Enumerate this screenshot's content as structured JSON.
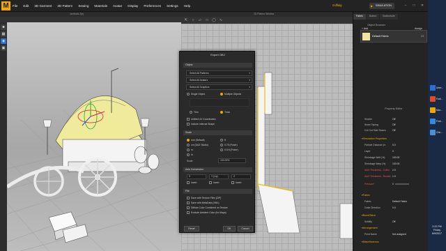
{
  "app": {
    "logo": "M",
    "user": "mdflaig",
    "simulation_label": "SIMULATION"
  },
  "menu": [
    "File",
    "Edit",
    "3D Garment",
    "2D Pattern",
    "Sewing",
    "Materials",
    "Avatar",
    "Display",
    "Preferences",
    "Settings",
    "Help"
  ],
  "window3d": {
    "title": "carnivals.Zprj"
  },
  "window2d": {
    "title": "2D Pattern Window"
  },
  "right_panel": {
    "tabs": [
      "Fabric",
      "Button",
      "Buttonhole"
    ],
    "object_browser_title": "Object Browser",
    "add_label": "+ Add",
    "assign_label": "Assign",
    "fabric": {
      "name": "Default Fabric",
      "count": "23"
    }
  },
  "property_editor": {
    "title": "Property Editor",
    "rows": [
      {
        "label": "Shader",
        "value": "Off"
      },
      {
        "label": "Seam Taping",
        "value": "Off"
      },
      {
        "label": "Cut Out Side Seams",
        "value": "Off"
      }
    ],
    "simulation_header": "Simulation Properties",
    "sim_rows": [
      {
        "label": "Particle Distance (m",
        "value": "5.0"
      },
      {
        "label": "Layer",
        "value": "0"
      },
      {
        "label": "Shrinkage Weft (%)",
        "value": "100.00"
      },
      {
        "label": "Shrinkage Warp (%)",
        "value": "100.00"
      },
      {
        "label": "Add'l Thickness - Collisi",
        "value": "2.5"
      },
      {
        "label": "Add'l Thickness - Render",
        "value": "1.0"
      }
    ],
    "pressure_label": "Pressure",
    "pressure_value": "0",
    "fabric_header": "Fabric",
    "fabric_rows": [
      {
        "label": "Fabric",
        "value": "Default Fabric"
      },
      {
        "label": "Grain Direction",
        "value": "0.0"
      }
    ],
    "bond_header": "Bond/Skive",
    "bond_rows": [
      {
        "label": "Solidify",
        "value": "Off"
      }
    ],
    "arrangement_header": "Arrangement",
    "arrangement_rows": [
      {
        "label": "Point Name",
        "value": "Not assigned"
      }
    ],
    "misc_header": "Miscellaneous"
  },
  "taskbar": {
    "items": [
      {
        "label": "Unre...",
        "color": "#2a6fd6"
      },
      {
        "label": "Furk...",
        "color": "#e24a2a"
      },
      {
        "label": "Mar...",
        "color": "#f0a800"
      },
      {
        "label": "Fork...",
        "color": "#3a86e0"
      },
      {
        "label": "Chri...",
        "color": "#4a90d9"
      }
    ],
    "time": "2:22 PM",
    "day": "Friday",
    "date": "6/9/2017"
  },
  "dialog": {
    "title": "Export OBJ",
    "object_section": "Object",
    "dropdowns": [
      "Select All Patterns",
      "Select All Avatars",
      "Select All Graphics"
    ],
    "single_object": "Single Object",
    "multiple_objects": "Multiple Objects",
    "option_a": "Thin",
    "option_b": "Thick",
    "unified_uv": "Unified UV Coordinates",
    "include_internal": "Include Internal Shape",
    "scale_section": "Scale",
    "scale_options": [
      {
        "label": "mm (Default)",
        "on": true
      },
      {
        "label": "cm (DAZ Studio)",
        "on": false
      },
      {
        "label": "m",
        "on": false
      },
      {
        "label": "in",
        "on": false
      }
    ],
    "scale_options_right": [
      {
        "label": "ft",
        "on": false
      },
      {
        "label": "0.75 (Poser)",
        "on": false
      },
      {
        "label": "0.6 ft (Poser)",
        "on": false
      }
    ],
    "scale_label": "Scale",
    "scale_value": "100.00%",
    "axis_section": "Axis Conversion",
    "axis_x": "X",
    "axis_y": "Y (Up)",
    "axis_z": "Z",
    "invert_label": "Invert",
    "file_section": "File",
    "file_opts": [
      {
        "label": "Save with Texture Files (ZIP)",
        "on": false
      },
      {
        "label": "Save with MetaData (XML)",
        "on": false
      },
      {
        "label": "Diffuse Color Combined on Texture",
        "on": false
      },
      {
        "label": "Exclude Ambient Color (for Maya)",
        "on": false
      }
    ],
    "reset_label": "Reset",
    "ok_label": "OK",
    "cancel_label": "Cancel"
  }
}
